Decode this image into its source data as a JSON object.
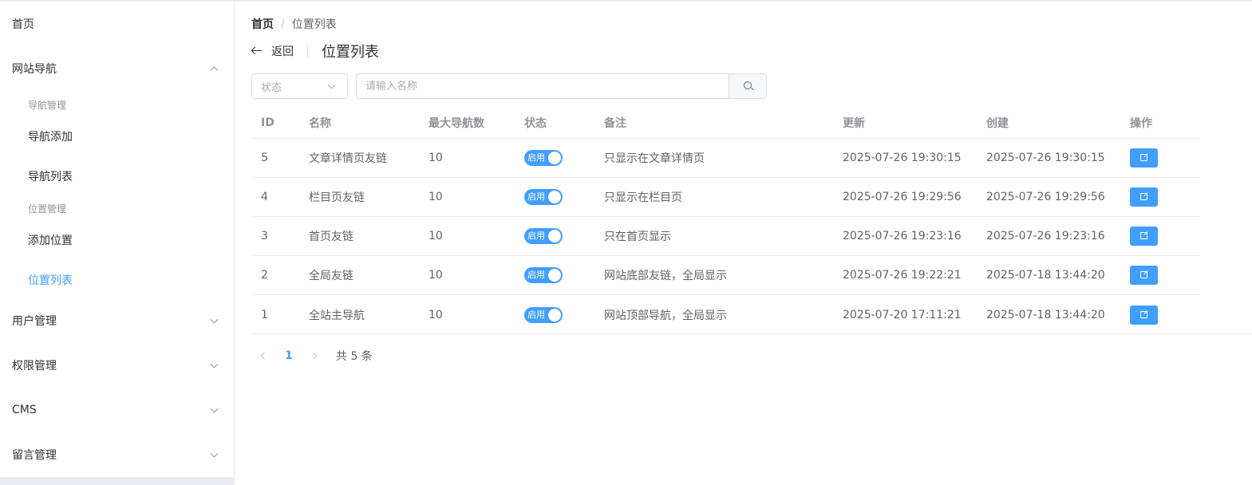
{
  "sidebar": {
    "home": "首页",
    "site_nav": {
      "label": "网站导航",
      "groups": [
        {
          "title": "导航管理",
          "items": [
            "导航添加",
            "导航列表"
          ]
        },
        {
          "title": "位置管理",
          "items": [
            "添加位置",
            "位置列表"
          ]
        }
      ]
    },
    "user_mgmt": "用户管理",
    "perm_mgmt": "权限管理",
    "cms": "CMS",
    "msg_mgmt": "留言管理"
  },
  "breadcrumb": {
    "home": "首页",
    "separator": "/",
    "current": "位置列表"
  },
  "header": {
    "back": "返回",
    "title": "位置列表"
  },
  "filters": {
    "status_placeholder": "状态",
    "search_placeholder": "请输入名称"
  },
  "table": {
    "columns": {
      "id": "ID",
      "name": "名称",
      "max_nav": "最大导航数",
      "status": "状态",
      "remark": "备注",
      "updated": "更新",
      "created": "创建",
      "ops": "操作"
    },
    "rows": [
      {
        "id": "5",
        "name": "文章详情页友链",
        "max_nav": "10",
        "status": "启用",
        "remark": "只显示在文章详情页",
        "updated": "2025-07-26 19:30:15",
        "created": "2025-07-26 19:30:15"
      },
      {
        "id": "4",
        "name": "栏目页友链",
        "max_nav": "10",
        "status": "启用",
        "remark": "只显示在栏目页",
        "updated": "2025-07-26 19:29:56",
        "created": "2025-07-26 19:29:56"
      },
      {
        "id": "3",
        "name": "首页友链",
        "max_nav": "10",
        "status": "启用",
        "remark": "只在首页显示",
        "updated": "2025-07-26 19:23:16",
        "created": "2025-07-26 19:23:16"
      },
      {
        "id": "2",
        "name": "全局友链",
        "max_nav": "10",
        "status": "启用",
        "remark": "网站底部友链，全局显示",
        "updated": "2025-07-26 19:22:21",
        "created": "2025-07-18 13:44:20"
      },
      {
        "id": "1",
        "name": "全站主导航",
        "max_nav": "10",
        "status": "启用",
        "remark": "网站顶部导航，全局显示",
        "updated": "2025-07-20 17:11:21",
        "created": "2025-07-18 13:44:20"
      }
    ]
  },
  "pagination": {
    "current_page": "1",
    "total_text": "共 5 条"
  },
  "colors": {
    "accent": "#409eff",
    "border": "#ebeef5",
    "text": "#303133",
    "muted": "#909399"
  }
}
